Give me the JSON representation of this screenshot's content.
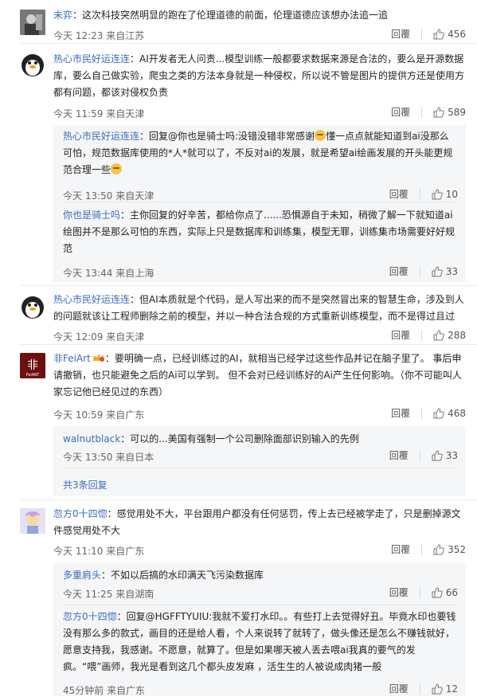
{
  "comments": [
    {
      "user": "未弈",
      "text": "：这次科技突然明显的跑在了伦理道德的前面，伦理道德应该想办法追一追",
      "time": "今天 12:23 来自江苏",
      "likes": "456",
      "reply_label": "回覆"
    },
    {
      "user": "热心市民好运连连",
      "text": "：AI开发者无人问责...模型训练一般都要求数据来源是合法的，要么是开源数据库，要么自己做实验，爬虫之类的方法本身就是一种侵权，所以说不管是图片的提供方还是使用方都有问题，都该对侵权负责",
      "time": "今天 11:59 来自天津",
      "likes": "589",
      "reply_label": "回覆",
      "replies": [
        {
          "user": "热心市民好运连连",
          "text": "：回复@你也是骑士吗:没错没错非常感谢",
          "text2": "懂一点点就能知道到ai没那么可怕，规范数据库使用的*人*就可以了，不反对ai的发展，就是希望ai绘画发展的开头能更规范合理一些",
          "time": "今天 13:50 来自天津",
          "likes": "10",
          "reply_label": "回覆"
        },
        {
          "user": "你也是骑士吗",
          "text": "：主你回复的好辛苦，都给你点了......恐惧源自于未知，稍微了解一下就知道ai绘图并不是那么可怕的东西，实际上只是数据库和训练集，模型无罪，训练集市场需要好好规范",
          "time": "今天 13:44 来自上海",
          "likes": "33",
          "reply_label": "回覆"
        }
      ]
    },
    {
      "user": "热心市民好运连连",
      "text": "：但AI本质就是个代码，是人写出来的而不是突然冒出来的智慧生命，涉及到人的问题就该让工程师删除之前的模型，并以一种合法合规的方式重新训练模型，而不是得过且过",
      "time": "今天 12:09 来自天津",
      "likes": "288",
      "reply_label": "回覆"
    },
    {
      "user": "非FeiArt",
      "badge": "",
      "text": "：要明确一点，已经训练过的AI，就相当已经学过这些作品并记在脑子里了。 事后申请撤销，也只能避免之后的Ai可以学到。 但不会对已经训练好的Ai产生任何影响。（你不可能叫人家忘记他已经见过的东西）",
      "time": "今天 10:59 来自广东",
      "likes": "468",
      "reply_label": "回覆",
      "replies": [
        {
          "user": "walnutblack",
          "text": "：可以的...美国有强制一个公司删除面部识别输入的先例",
          "time": "今天 13:50 来自日本",
          "likes": "33",
          "reply_label": "回覆"
        }
      ],
      "more": "共3条回复"
    },
    {
      "user": "忽方0十四惚",
      "text": "：感觉用处不大，平台跟用户都没有任何惩罚，传上去已经被学走了，只是删掉源文件感觉用处不大",
      "time": "今天 11:10 来自广东",
      "likes": "352",
      "reply_label": "回覆",
      "replies": [
        {
          "user": "多重肩头",
          "text": "：不如以后搞的水印满天飞污染数据库",
          "time": "今天 11:25 来自湖南",
          "likes": "66",
          "reply_label": "回覆"
        },
        {
          "user": "忽方0十四惚",
          "text": "：回复@HGFFTYUIU:我就不爱打水印。。有些打上去觉得好丑。毕竟水印也要钱没有那么多的款式，画目的还是给人看，个人来说转了就转了，做头像还是怎么不赚钱就好，愿意支持我，我感谢。不愿意，就算了。但是如果哪天被人丢去喂ai我真的要气的发疯。“喂”画师，我光是看到这几个都头皮发麻 ，活生生的人被说成肉猪一般",
          "time": "45分钟前 来自广东",
          "likes": "12",
          "reply_label": "回覆"
        }
      ]
    }
  ]
}
